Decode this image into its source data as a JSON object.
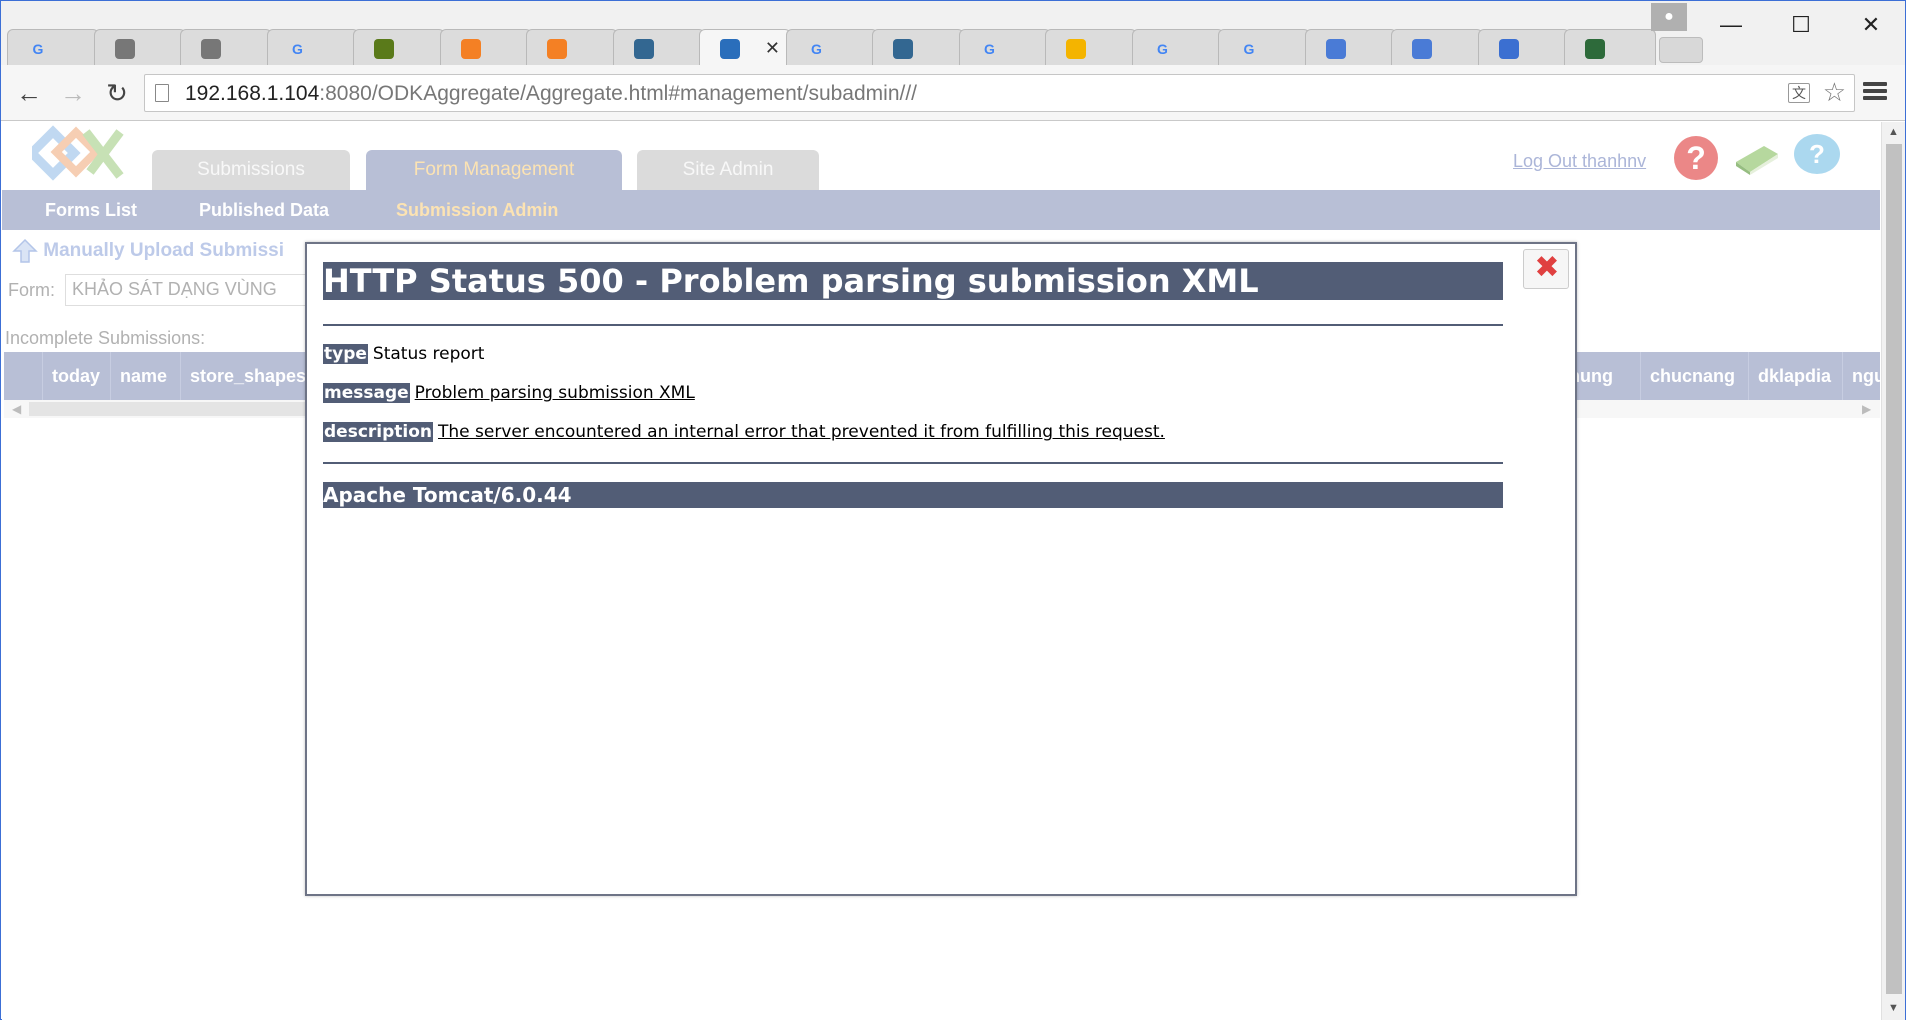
{
  "browser": {
    "url_host": "192.168.1.104",
    "url_rest": ":8080/ODKAggregate/Aggregate.html#management/subadmin///",
    "tabs": [
      {
        "icon": "google-icon",
        "glyph": "G",
        "color": "#4285f4"
      },
      {
        "icon": "page-icon",
        "glyph": "",
        "color": "#777777"
      },
      {
        "icon": "page-icon",
        "glyph": "",
        "color": "#777777"
      },
      {
        "icon": "google-icon",
        "glyph": "G",
        "color": "#4285f4"
      },
      {
        "icon": "app-icon",
        "glyph": "",
        "color": "#5a7a1a"
      },
      {
        "icon": "stackoverflow-icon",
        "glyph": "",
        "color": "#f48024"
      },
      {
        "icon": "stackoverflow-icon",
        "glyph": "",
        "color": "#f48024"
      },
      {
        "icon": "postgres-icon",
        "glyph": "",
        "color": "#336791"
      },
      {
        "icon": "odk-icon",
        "glyph": "",
        "color": "#2a6ebb",
        "active": true
      },
      {
        "icon": "google-icon",
        "glyph": "G",
        "color": "#4285f4"
      },
      {
        "icon": "postgres-icon",
        "glyph": "",
        "color": "#336791"
      },
      {
        "icon": "google-icon",
        "glyph": "G",
        "color": "#4285f4"
      },
      {
        "icon": "chrome-icon",
        "glyph": "",
        "color": "#f4b400"
      },
      {
        "icon": "google-icon",
        "glyph": "G",
        "color": "#4285f4"
      },
      {
        "icon": "google-icon",
        "glyph": "G",
        "color": "#4285f4"
      },
      {
        "icon": "feedback-icon",
        "glyph": "",
        "color": "#4a7bd6"
      },
      {
        "icon": "feedback-icon",
        "glyph": "",
        "color": "#4a7bd6"
      },
      {
        "icon": "parking-icon",
        "glyph": "",
        "color": "#3b6fd1"
      },
      {
        "icon": "maps-icon",
        "glyph": "",
        "color": "#2d6a3a"
      }
    ]
  },
  "header": {
    "tabs": [
      {
        "label": "Submissions",
        "active": false
      },
      {
        "label": "Form Management",
        "active": true
      },
      {
        "label": "Site Admin",
        "active": false
      }
    ],
    "logout": "Log Out thanhnv"
  },
  "subnav": {
    "items": [
      "Forms List",
      "Published Data",
      "Submission Admin"
    ],
    "current": "Submission Admin"
  },
  "content": {
    "upload_label": "Manually Upload Submissi",
    "form_label": "Form:",
    "form_value": "KHẢO SÁT DẠNG VÙNG",
    "incomplete_label": "Incomplete Submissions:",
    "columns_left": [
      "today",
      "name",
      "store_shapes"
    ],
    "columns_right": [
      "ttraihung",
      "chucnang",
      "dklapdia",
      "nguo"
    ]
  },
  "dialog": {
    "title": "HTTP Status 500 - Problem parsing submission XML",
    "type_label": "type",
    "type_value": "Status report",
    "message_label": "message",
    "message_value": "Problem parsing submission XML",
    "description_label": "description",
    "description_value": "The server encountered an internal error that prevented it from fulfilling this request.",
    "footer": "Apache Tomcat/6.0.44"
  },
  "colors": {
    "nav_bg": "#939dc1",
    "nav_active_text": "#fbd58a",
    "tomcat_bar": "#525d76"
  }
}
